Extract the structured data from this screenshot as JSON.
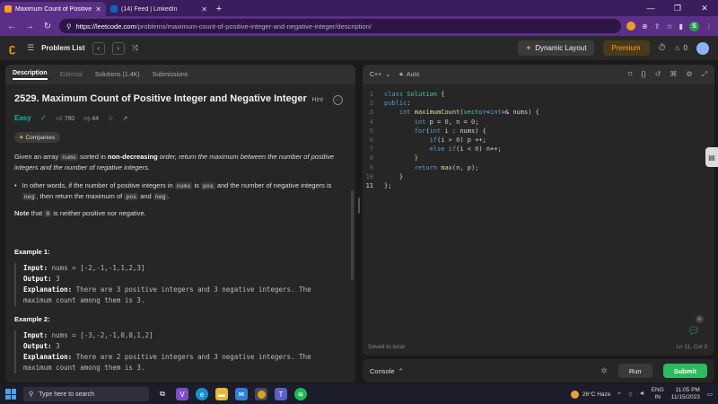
{
  "browser": {
    "tabs": [
      {
        "title": "Maximum Count of Positive Inte...",
        "active": true
      },
      {
        "title": "(14) Feed | LinkedIn",
        "active": false
      }
    ],
    "url_host": "https://leetcode.com",
    "url_path": "/problems/maximum-count-of-positive-integer-and-negative-integer/description/",
    "profile_initial": "S"
  },
  "header": {
    "problem_list": "Problem List",
    "dynamic_layout": "Dynamic Layout",
    "premium": "Premium",
    "streak": "0"
  },
  "left": {
    "tabs": [
      "Description",
      "Editorial",
      "Solutions (1.4K)",
      "Submissions"
    ],
    "title": "2529. Maximum Count of Positive Integer and Negative Integer",
    "hint": "Hint",
    "difficulty": "Easy",
    "likes": "780",
    "dislikes": "44",
    "companies": "Companies",
    "desc_1": "Given an array ",
    "desc_nums": "nums",
    "desc_2": " sorted in ",
    "desc_bold": "non-decreasing",
    "desc_3": " order, return the maximum between the number of positive integers and the number of negative integers.",
    "bullet_1": "In other words, if the number of positive integers in ",
    "bullet_nums": "nums",
    "bullet_2": " is ",
    "bullet_pos": "pos",
    "bullet_3": " and the number of negative integers is ",
    "bullet_neg": "neg",
    "bullet_4": ", then return the maximum of ",
    "bullet_pos2": "pos",
    "bullet_5": " and ",
    "bullet_neg2": "neg",
    "bullet_6": ".",
    "note_label": "Note",
    "note_1": " that ",
    "note_zero": "0",
    "note_2": " is neither positive nor negative.",
    "example1": {
      "heading": "Example 1:",
      "input_label": "Input:",
      "input": " nums = [-2,-1,-1,1,2,3]",
      "output_label": "Output:",
      "output": " 3",
      "expl_label": "Explanation:",
      "expl_1": " There are 3 positive integers and 3 negative integers. The",
      "expl_2": "maximum count among them is 3."
    },
    "example2": {
      "heading": "Example 2:",
      "input_label": "Input:",
      "input": " nums = [-3,-2,-1,0,0,1,2]",
      "output_label": "Output:",
      "output": " 3",
      "expl_label": "Explanation:",
      "expl_1": " There are 2 positive integers and 3 negative integers. The",
      "expl_2": "maximum count among them is 3."
    }
  },
  "editor": {
    "language": "C++",
    "mode": "Auto",
    "line_numbers": [
      "1",
      "2",
      "3",
      "4",
      "5",
      "6",
      "7",
      "8",
      "9",
      "10",
      "11"
    ],
    "saved": "Saved to local",
    "cursor": "Ln 11, Col 3"
  },
  "console": {
    "label": "Console",
    "run": "Run",
    "submit": "Submit"
  },
  "taskbar": {
    "search": "Type here to search",
    "weather": "26°C  Haze",
    "lang_1": "ENG",
    "lang_2": "IN",
    "time": "11:05 PM",
    "date": "11/15/2023"
  },
  "colors": {
    "accent": "#ffa116",
    "easy": "#00b8a3",
    "submit": "#2cbb5d"
  }
}
